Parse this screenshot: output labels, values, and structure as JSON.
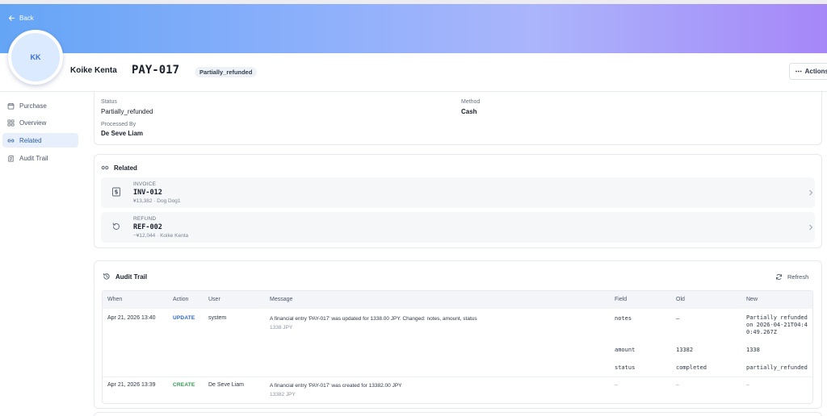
{
  "nav": {
    "back_label": "Back"
  },
  "profile": {
    "initials": "KK",
    "name": "Koike Kenta"
  },
  "payment": {
    "id": "PAY-017",
    "status_badge": "Partially_refunded"
  },
  "toolbar": {
    "actions_label": "Actions"
  },
  "sidebar": {
    "items": [
      {
        "label": "Purchase",
        "icon": "calendar-icon",
        "active": false
      },
      {
        "label": "Overview",
        "icon": "grid-icon",
        "active": false
      },
      {
        "label": "Related",
        "icon": "link-icon",
        "active": true
      },
      {
        "label": "Audit Trail",
        "icon": "clipboard-icon",
        "active": false
      }
    ]
  },
  "details": {
    "status_label": "Status",
    "status_value": "Partially_refunded",
    "method_label": "Method",
    "method_value": "Cash",
    "processed_label": "Processed By",
    "processed_value": "De Seve Liam"
  },
  "related": {
    "title": "Related",
    "items": [
      {
        "type": "INVOICE",
        "code": "INV-012",
        "sub": "¥13,382 · Dog Dog1",
        "icon": "dollar-doc-icon"
      },
      {
        "type": "REFUND",
        "code": "REF-002",
        "sub": "−¥12,044 · Koike Kenta",
        "icon": "rotate-ccw-icon"
      }
    ]
  },
  "audit": {
    "title": "Audit Trail",
    "refresh_label": "Refresh",
    "columns": [
      "When",
      "Action",
      "User",
      "Message",
      "Field",
      "Old",
      "New"
    ],
    "rows": [
      {
        "when": "Apr 21, 2026 13:40",
        "action": "UPDATE",
        "user": "system",
        "message": "A financial entry 'PAY-017' was updated for 1338.00 JPY. Changed: notes, amount, status",
        "sub": "1338 JPY",
        "changes": [
          {
            "field": "notes",
            "old": "—",
            "new_lines": [
              "Partially refunded",
              "on 2026-04-21T04:4",
              "0:49.267Z"
            ]
          },
          {
            "field": "amount",
            "old": "13382",
            "new_lines": [
              "1338"
            ]
          },
          {
            "field": "status",
            "old": "completed",
            "new_lines": [
              "partially_refunded"
            ]
          }
        ]
      },
      {
        "when": "Apr 21, 2026 13:39",
        "action": "CREATE",
        "user": "De Seve Liam",
        "message": "A financial entry 'PAY-017' was created for 13382.00 JPY",
        "sub": "13382 JPY",
        "changes": [
          {
            "field": "–",
            "old": "–",
            "new_lines": [
              "–"
            ]
          }
        ]
      }
    ]
  },
  "colors": {
    "accent": "#2c66c6",
    "create": "#2f9a50",
    "gradient_start": "#65a5f6",
    "gradient_end": "#a687f8"
  }
}
